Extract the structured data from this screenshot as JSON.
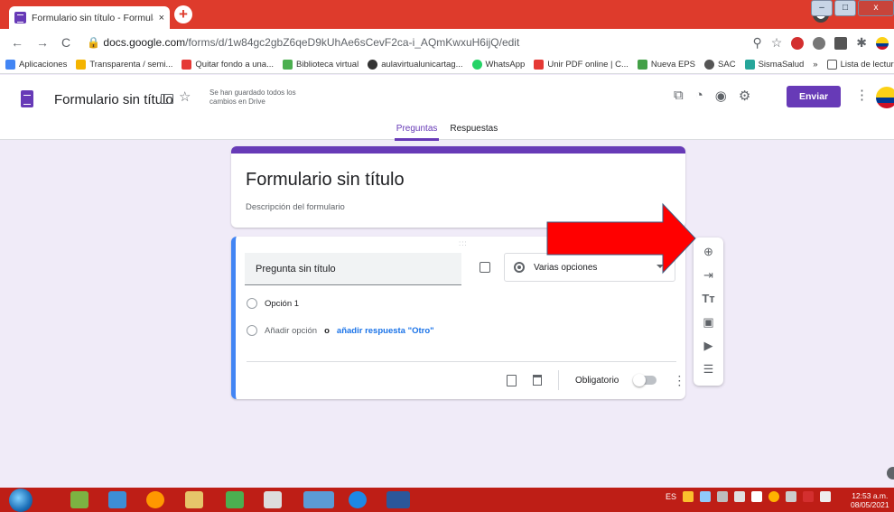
{
  "browser": {
    "tab_title": "Formulario sin título - Formulario",
    "tab_close": "×",
    "new_tab": "+",
    "url_host": "docs.google.com",
    "url_path": "/forms/d/1w84gc2gbZ6qeD9kUhAe6sCevF2ca-i_AQmKwxuH6ijQ/edit",
    "back": "←",
    "forward": "→",
    "reload": "C"
  },
  "bookmarks": [
    {
      "label": "Aplicaciones",
      "color": "#4285f4"
    },
    {
      "label": "Transparenta / semi...",
      "color": "#f4b400"
    },
    {
      "label": "Quitar fondo a una...",
      "color": "#e53935"
    },
    {
      "label": "Biblioteca virtual",
      "color": "#4caf50"
    },
    {
      "label": "aulavirtualunicartag...",
      "color": "#333333"
    },
    {
      "label": "WhatsApp",
      "color": "#25d366"
    },
    {
      "label": "Unir PDF online | C...",
      "color": "#e53935"
    },
    {
      "label": "Nueva EPS",
      "color": "#43a047"
    },
    {
      "label": "SAC",
      "color": "#555555"
    },
    {
      "label": "SismaSalud",
      "color": "#26a69a"
    }
  ],
  "bookmarks_more": "»",
  "bookmarks_reading_list": "Lista de lectura",
  "forms": {
    "doc_title": "Formulario sin título",
    "saved_status": "Se han guardado todos los cambios en Drive",
    "send_label": "Enviar",
    "tabs": [
      "Preguntas",
      "Respuestas"
    ],
    "accent": "#673ab7"
  },
  "form": {
    "title": "Formulario sin título",
    "description": "Descripción del formulario"
  },
  "question": {
    "handle": ":::",
    "title": "Pregunta sin título",
    "type": "Varias opciones",
    "option1": "Opción 1",
    "add_option": "Añadir opción",
    "or": "o",
    "add_other": "añadir respuesta \"Otro\"",
    "required_label": "Obligatorio",
    "more": "⋮"
  },
  "floating_toolbar": {
    "icons": [
      "add-question-icon",
      "import-questions-icon",
      "add-title-icon",
      "add-image-icon",
      "add-video-icon",
      "add-section-icon"
    ]
  },
  "taskbar": {
    "language": "ES",
    "time": "12:53 a.m.",
    "date": "08/05/2021"
  }
}
